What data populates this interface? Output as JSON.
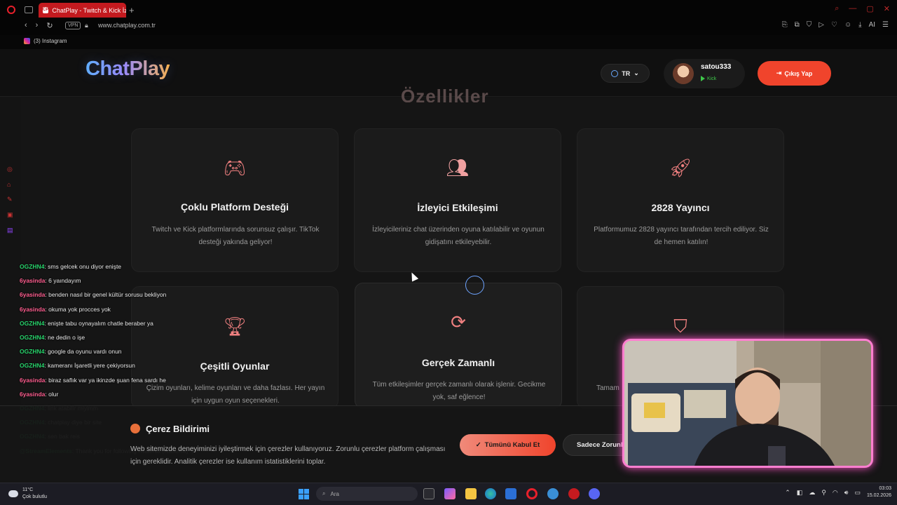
{
  "browser": {
    "tab_title": "ChatPlay - Twitch & Kick İz",
    "tab_favicon": "CP",
    "url": "www.chatplay.com.tr",
    "vpn_label": "VPN",
    "bookmark_instagram": "(3) Instagram",
    "toolbar_ai": "AI"
  },
  "site": {
    "logo": "ChatPlay",
    "lang": "TR",
    "username": "satou333",
    "platform": "Kick",
    "logout_label": "Çıkış Yap",
    "section_heading": "Özellikler"
  },
  "cards": [
    {
      "icon": "gamepad-icon",
      "title": "Çoklu Platform Desteği",
      "desc": "Twitch ve Kick platformlarında sorunsuz çalışır. TikTok desteği yakında geliyor!"
    },
    {
      "icon": "users-icon",
      "title": "İzleyici Etkileşimi",
      "desc": "İzleyicileriniz chat üzerinden oyuna katılabilir ve oyunun gidişatını etkileyebilir."
    },
    {
      "icon": "rocket-icon",
      "title": "2828 Yayıncı",
      "desc": "Platformumuz 2828 yayıncı tarafından tercih ediliyor. Siz de hemen katılın!"
    },
    {
      "icon": "trophy-icon",
      "title": "Çeşitli Oyunlar",
      "desc": "Çizim oyunları, kelime oyunları ve daha fazlası. Her yayın için uygun oyun seçenekleri."
    },
    {
      "icon": "sync-icon",
      "title": "Gerçek Zamanlı",
      "desc": "Tüm etkileşimler gerçek zamanlı olarak işlenir. Gecikme yok, saf eğlence!"
    },
    {
      "icon": "shield-icon",
      "title": "",
      "desc": "Tamam"
    }
  ],
  "chat": [
    {
      "user": "OGZHN4",
      "color": "o",
      "msg": "sms gelcek onu diyor enişte"
    },
    {
      "user": "6yasinda",
      "color": "r",
      "msg": "6 yaındayım"
    },
    {
      "user": "6yasinda",
      "color": "r",
      "msg": "benden nasıl bir genel kültür sorusu bekliyon"
    },
    {
      "user": "6yasinda",
      "color": "r",
      "msg": "okuma yok procces yok"
    },
    {
      "user": "OGZHN4",
      "color": "o",
      "msg": "enişte tabu oynayalım chatle beraber ya"
    },
    {
      "user": "OGZHN4",
      "color": "o",
      "msg": "ne dedin o işe"
    },
    {
      "user": "OGZHN4",
      "color": "o",
      "msg": "google da oyunu vardı onun"
    },
    {
      "user": "OGZHN4",
      "color": "o",
      "msg": "kameranı İşaretli yere çekiyorsun"
    },
    {
      "user": "6yasinda",
      "color": "r",
      "msg": "biraz saflık var ya ikinzde şuan fena sardı he"
    },
    {
      "user": "6yasinda",
      "color": "r",
      "msg": "olur"
    },
    {
      "user": "OGZHN4",
      "color": "o",
      "msg": "link atabilir miyimm"
    },
    {
      "user": "OGZHN4",
      "color": "o",
      "msg": "chatplay diye bir site"
    },
    {
      "user": "OGZHN4",
      "color": "o",
      "msg": "sen bak reis"
    },
    {
      "user": "@StreamElements",
      "color": "o",
      "msg": "Thank you for following Radenia (Radenia) :)"
    }
  ],
  "cookie": {
    "title": "Çerez Bildirimi",
    "text": "Web sitemizde deneyiminizi iyileştirmek için çerezler kullanıyoruz. Zorunlu çerezler platform çalışması için gereklidir. Analitik çerezler ise kullanım istatistiklerini toplar.",
    "accept_all": "Tümünü Kabul Et",
    "only_required": "Sadece Zorunlu"
  },
  "taskbar": {
    "weather_temp": "11°C",
    "weather_desc": "Çok bulutlu",
    "search_placeholder": "Ara",
    "time": "03:03",
    "date": "15.02.2026"
  },
  "colors": {
    "accent": "#f0442c",
    "kick_green": "#3ec84a",
    "webcam_border": "#ff7fd0"
  }
}
